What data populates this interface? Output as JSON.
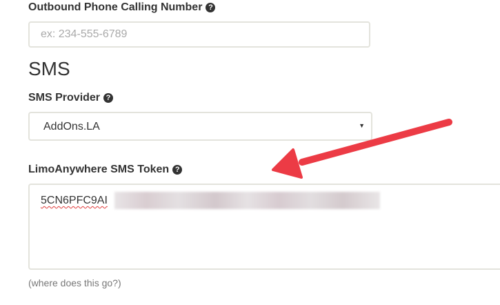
{
  "phone": {
    "label": "Outbound Phone Calling Number",
    "placeholder": "ex: 234-555-6789",
    "value": ""
  },
  "sms": {
    "section_title": "SMS",
    "provider": {
      "label": "SMS Provider",
      "selected": "AddOns.LA"
    },
    "token": {
      "label": "LimoAnywhere SMS Token",
      "visible_value": "5CN6PFC9AI"
    },
    "hint": "(where does this go?)"
  },
  "icons": {
    "help": "question-circle-icon",
    "caret": "caret-down-icon",
    "annotation": "red-arrow"
  },
  "colors": {
    "text": "#333333",
    "border": "#e3e3dc",
    "placeholder": "#a9a9a9",
    "hint": "#777777",
    "arrow": "#ec3b45"
  }
}
